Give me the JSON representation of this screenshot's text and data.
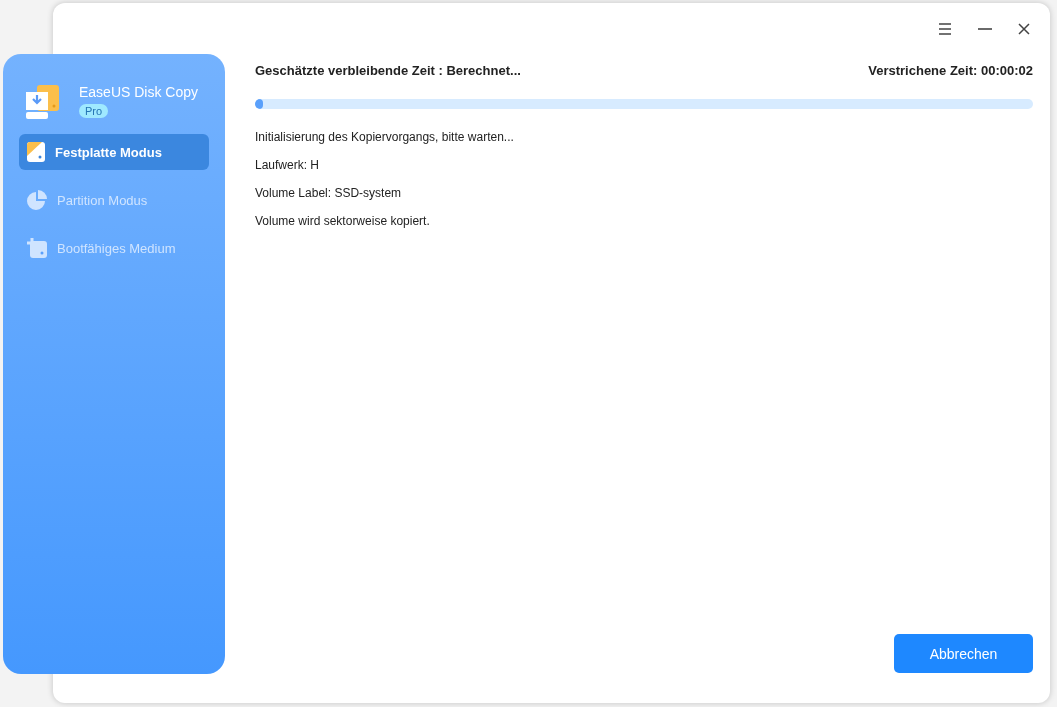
{
  "app": {
    "name": "EaseUS Disk Copy",
    "badge": "Pro"
  },
  "sidebar": {
    "items": [
      {
        "label": "Festplatte Modus",
        "kind": "disk",
        "selected": true,
        "disabled": false
      },
      {
        "label": "Partition Modus",
        "kind": "partition",
        "selected": false,
        "disabled": true
      },
      {
        "label": "Bootfähiges Medium",
        "kind": "boot",
        "selected": false,
        "disabled": true
      }
    ]
  },
  "progress": {
    "remaining": "Geschätzte verbleibende Zeit : Berechnet...",
    "elapsed": "Verstrichene Zeit: 00:00:02",
    "level": 0.01
  },
  "log": [
    "Initialisierung des Kopiervorgangs, bitte warten...",
    "Laufwerk: H",
    "Volume Label: SSD-system",
    "Volume wird sektorweise kopiert."
  ],
  "buttons": {
    "cancel": "Abbrechen"
  }
}
